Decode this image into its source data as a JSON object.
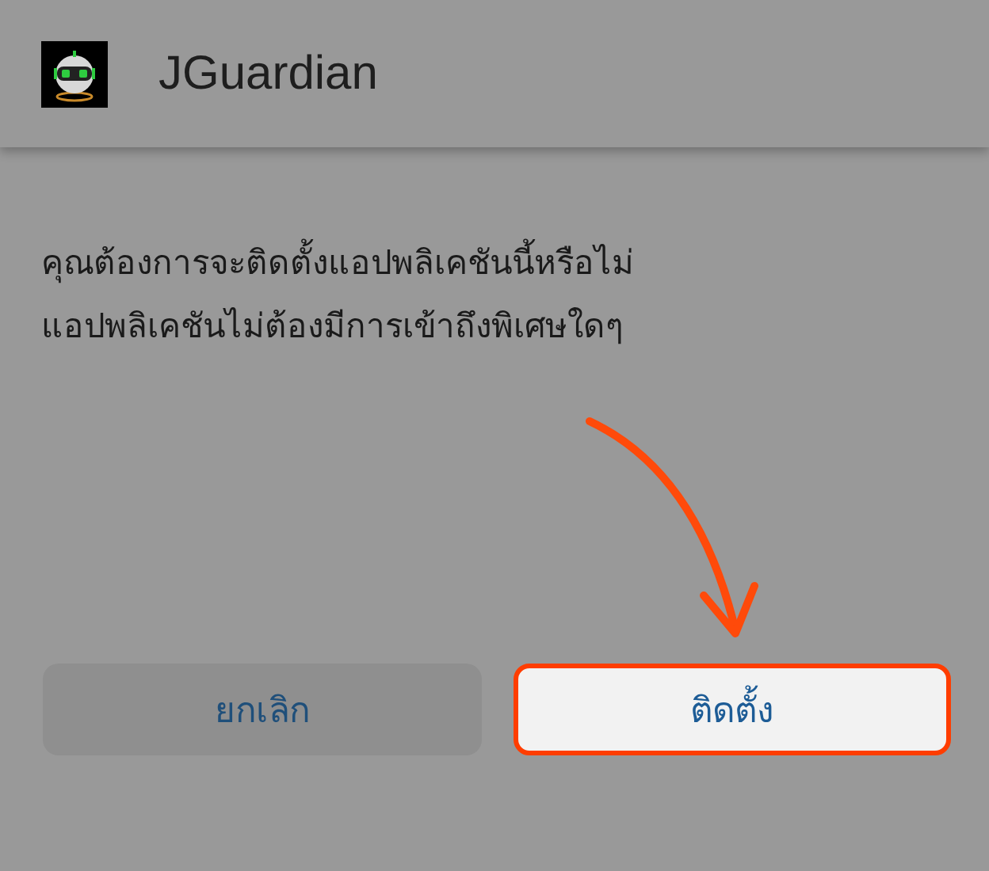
{
  "app_bar": {
    "title": "JGuardian"
  },
  "message": [
    "คุณต้องการจะติดตั้งแอปพลิเคชันนี้หรือไม่",
    "แอปพลิเคชันไม่ต้องมีการเข้าถึงพิเศษใดๆ"
  ],
  "buttons": [
    {
      "label": "ยกเลิก",
      "highlighted": false
    },
    {
      "label": "ติดตั้ง",
      "highlighted": true
    }
  ]
}
